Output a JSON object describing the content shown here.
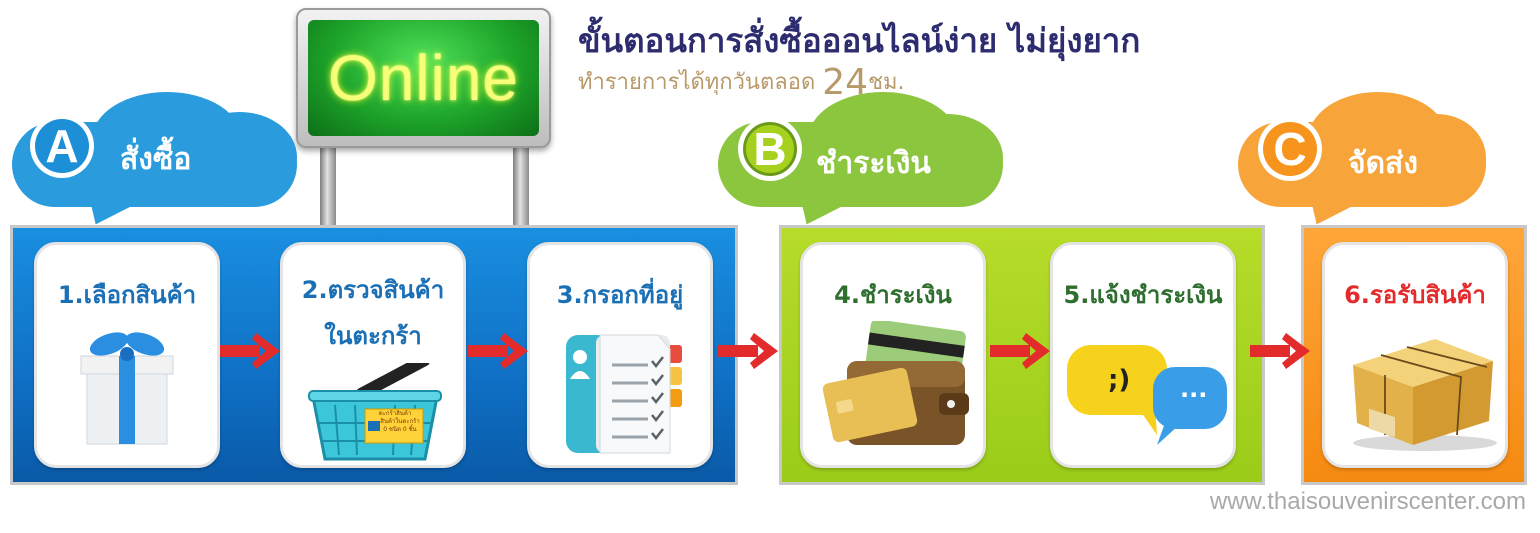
{
  "sign": {
    "text": "Online"
  },
  "header": {
    "title": "ขั้นตอนการสั่งซื้อออนไลน์ง่าย ไม่ยุ่งยาก",
    "subtitle_prefix": "ทำรายการได้ทุกวันตลอด",
    "subtitle_number": "24",
    "subtitle_unit": "ชม."
  },
  "stages": [
    {
      "letter": "A",
      "label": "สั่งซื้อ",
      "color": "#1e90d8"
    },
    {
      "letter": "B",
      "label": "ชำระเงิน",
      "color": "#8cc63e"
    },
    {
      "letter": "C",
      "label": "จัดส่ง",
      "color": "#f7941d"
    }
  ],
  "steps": [
    {
      "label": "1.เลือกสินค้า",
      "icon": "gift-box-icon",
      "color": "#1a6fb5"
    },
    {
      "label_line1": "2.ตรวจสินค้า",
      "label_line2": "ในตะกร้า",
      "icon": "shopping-basket-icon",
      "color": "#1a6fb5"
    },
    {
      "label": "3.กรอกที่อยู่",
      "icon": "address-book-icon",
      "color": "#1a6fb5"
    },
    {
      "label": "4.ชำระเงิน",
      "icon": "wallet-icon",
      "color": "#2e6e2e"
    },
    {
      "label": "5.แจ้งชำระเงิน",
      "icon": "chat-bubbles-icon",
      "color": "#2e6e2e"
    },
    {
      "label": "6.รอรับสินค้า",
      "icon": "parcel-box-icon",
      "color": "#e32b2b"
    }
  ],
  "basket_tag": {
    "line1": "ตะกร้าสินค้า",
    "line2": "สินค้าในตะกร้า",
    "line3": "0 ชนิด 0 ชิ้น"
  },
  "chat": {
    "smiley": ";)",
    "dots": "..."
  },
  "watermark": "www.thaisouvenirscenter.com"
}
